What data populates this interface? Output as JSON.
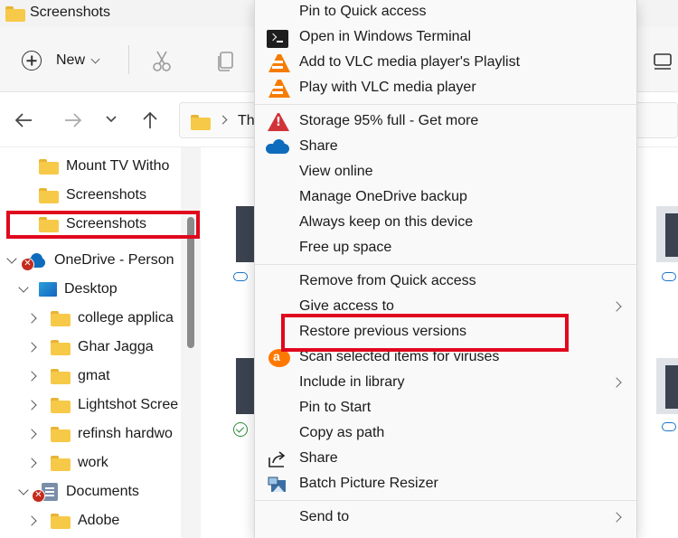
{
  "window": {
    "title": "Screenshots"
  },
  "toolbar": {
    "new_label": "New"
  },
  "address_bar": {
    "crumb": "Th"
  },
  "sidebar": {
    "quick_access": [
      {
        "label": "Mount TV Witho"
      },
      {
        "label": "Screenshots"
      },
      {
        "label": "Screenshots",
        "selected": true
      }
    ],
    "onedrive": {
      "label": "OneDrive - Person",
      "status": "error"
    },
    "desktop": {
      "label": "Desktop"
    },
    "desktop_children": [
      {
        "label": "college applica"
      },
      {
        "label": "Ghar Jagga"
      },
      {
        "label": "gmat"
      },
      {
        "label": "Lightshot Scree"
      },
      {
        "label": "refinsh hardwo"
      },
      {
        "label": "work"
      }
    ],
    "documents": {
      "label": "Documents",
      "status": "error"
    },
    "documents_children": [
      {
        "label": "Adobe"
      }
    ]
  },
  "context_menu": {
    "items": [
      {
        "label": "Pin to Quick access",
        "icon": "none"
      },
      {
        "label": "Open in Windows Terminal",
        "icon": "terminal-icon"
      },
      {
        "label": "Add to VLC media player's Playlist",
        "icon": "vlc-icon"
      },
      {
        "label": "Play with VLC media player",
        "icon": "vlc-icon"
      },
      {
        "label": "Storage 95% full - Get more",
        "icon": "warning-icon"
      },
      {
        "label": "Share",
        "icon": "onedrive-icon"
      },
      {
        "label": "View online",
        "icon": "none"
      },
      {
        "label": "Manage OneDrive backup",
        "icon": "none"
      },
      {
        "label": "Always keep on this device",
        "icon": "none"
      },
      {
        "label": "Free up space",
        "icon": "none"
      },
      {
        "label": "Remove from Quick access",
        "icon": "none"
      },
      {
        "label": "Give access to",
        "icon": "none",
        "submenu": true
      },
      {
        "label": "Restore previous versions",
        "icon": "none",
        "highlighted": true
      },
      {
        "label": "Scan selected items for viruses",
        "icon": "avast-icon"
      },
      {
        "label": "Include in library",
        "icon": "none",
        "submenu": true
      },
      {
        "label": "Pin to Start",
        "icon": "none"
      },
      {
        "label": "Copy as path",
        "icon": "none"
      },
      {
        "label": "Share",
        "icon": "share-icon"
      },
      {
        "label": "Batch Picture Resizer",
        "icon": "resizer-icon"
      },
      {
        "label": "Send to",
        "icon": "none",
        "submenu": true
      }
    ]
  },
  "colors": {
    "highlight_box": "#e0081e",
    "folder": "#f7c948",
    "onedrive": "#0f6cbd",
    "vlc": "#f57c00",
    "warning": "#d13438"
  }
}
